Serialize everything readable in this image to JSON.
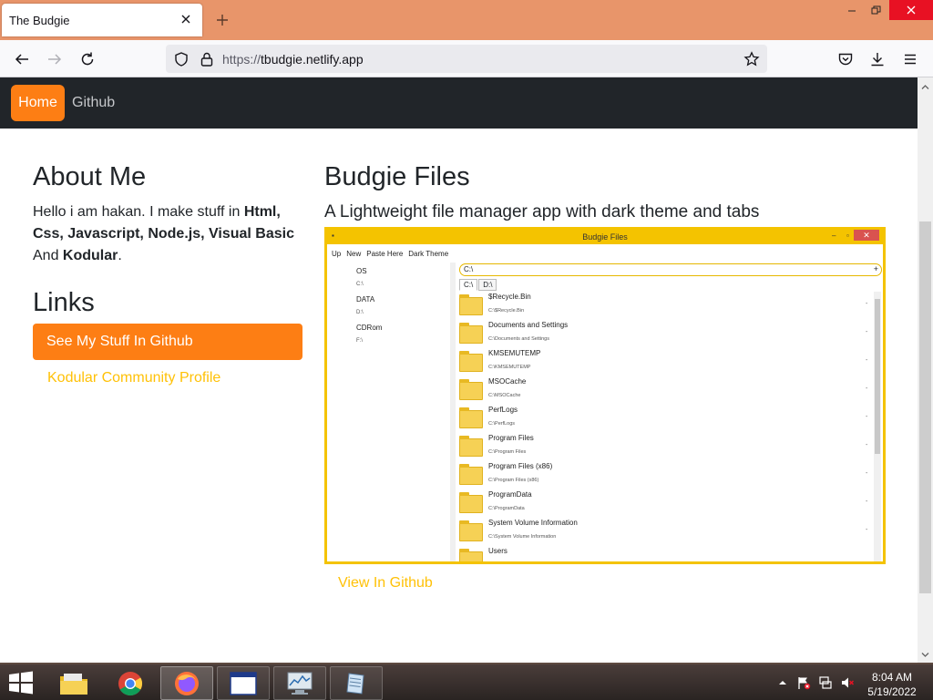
{
  "browser": {
    "tab_title": "The Budgie",
    "url_scheme": "https://",
    "url_host": "tbudgie.netlify.app"
  },
  "site_nav": {
    "home": "Home",
    "github": "Github"
  },
  "about": {
    "heading": "About Me",
    "intro": "Hello i am hakan. I make stuff in ",
    "html": "Html,",
    "css": "Css,",
    "javascript": "Javascript,",
    "nodejs": "Node.js,",
    "vb": "Visual Basic",
    "and": "And",
    "kodular": "Kodular",
    "period": "."
  },
  "links": {
    "heading": "Links",
    "github_button": "See My Stuff In Github",
    "kodular_profile": "Kodular Community Profile"
  },
  "budgie": {
    "heading": "Budgie Files",
    "subtitle": "A Lightweight file manager app with dark theme and tabs",
    "view_github": "View In Github",
    "preview": {
      "title": "Budgie Files",
      "menu": [
        "Up",
        "New",
        "Paste Here",
        "Dark Theme"
      ],
      "drives": [
        {
          "label": "OS",
          "path": "C:\\"
        },
        {
          "label": "DATA",
          "path": "D:\\"
        },
        {
          "label": "CDRom",
          "path": "F:\\"
        }
      ],
      "path_value": "C:\\",
      "plus": "+",
      "tabs": [
        "C:\\",
        "D:\\"
      ],
      "items": [
        {
          "name": "$Recycle.Bin",
          "path": "C:\\$Recycle.Bin"
        },
        {
          "name": "Documents and Settings",
          "path": "C:\\Documents and Settings"
        },
        {
          "name": "KMSEMUTEMP",
          "path": "C:\\KMSEMUTEMP"
        },
        {
          "name": "MSOCache",
          "path": "C:\\MSOCache"
        },
        {
          "name": "PerfLogs",
          "path": "C:\\PerfLogs"
        },
        {
          "name": "Program Files",
          "path": "C:\\Program Files"
        },
        {
          "name": "Program Files (x86)",
          "path": "C:\\Program Files (x86)"
        },
        {
          "name": "ProgramData",
          "path": "C:\\ProgramData"
        },
        {
          "name": "System Volume Information",
          "path": "C:\\System Volume Information"
        },
        {
          "name": "Users",
          "path": ""
        }
      ]
    }
  },
  "taskbar": {
    "time": "8:04 AM",
    "date": "5/19/2022"
  },
  "colors": {
    "accent_orange": "#fd7e14",
    "link_yellow": "#ffc107",
    "navbar_dark": "#212529",
    "tabbar": "#e8956a"
  }
}
